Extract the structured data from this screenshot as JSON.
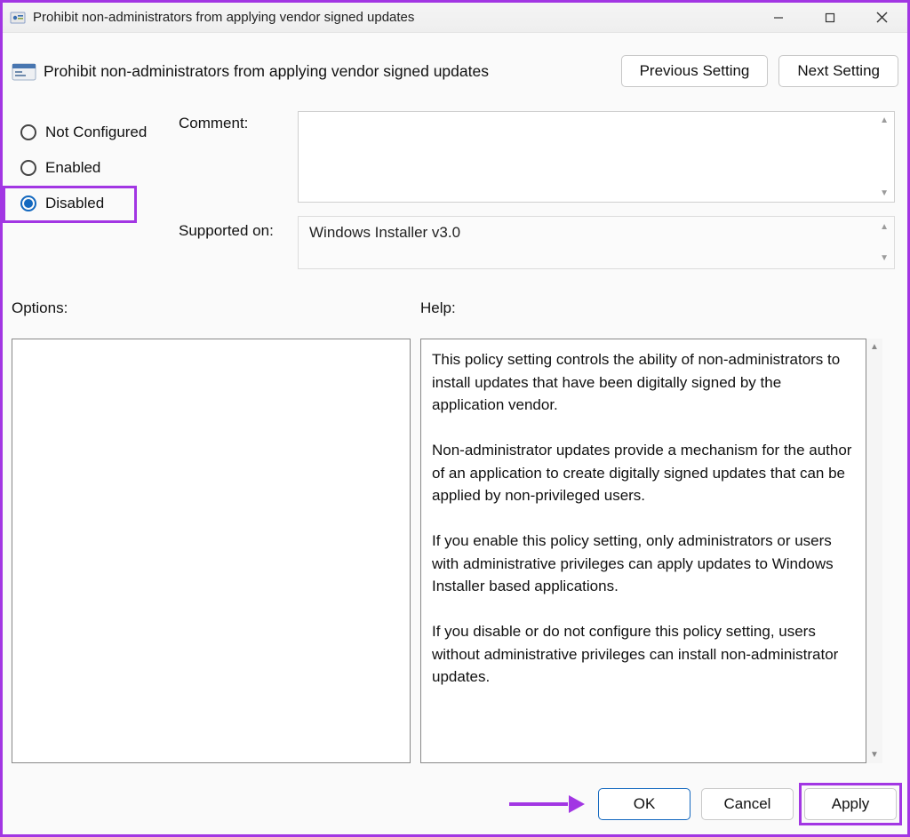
{
  "window": {
    "title": "Prohibit non-administrators from applying vendor signed updates"
  },
  "header": {
    "policy_title": "Prohibit non-administrators from applying vendor signed updates",
    "prev_label": "Previous Setting",
    "next_label": "Next Setting"
  },
  "state": {
    "options": [
      "Not Configured",
      "Enabled",
      "Disabled"
    ],
    "selected_index": 2
  },
  "labels": {
    "comment": "Comment:",
    "supported": "Supported on:",
    "options": "Options:",
    "help": "Help:"
  },
  "comment": {
    "value": ""
  },
  "supported": {
    "value": "Windows Installer v3.0"
  },
  "help": {
    "text": "This policy setting controls the ability of non-administrators to install updates that have been digitally signed by the application vendor.\n\nNon-administrator updates provide a mechanism for the author of an application to create digitally signed updates that can be applied by non-privileged users.\n\nIf you enable this policy setting, only administrators or users with administrative privileges can apply updates to Windows Installer based applications.\n\nIf you disable or do not configure this policy setting, users without administrative privileges can install non-administrator updates."
  },
  "buttons": {
    "ok": "OK",
    "cancel": "Cancel",
    "apply": "Apply"
  }
}
